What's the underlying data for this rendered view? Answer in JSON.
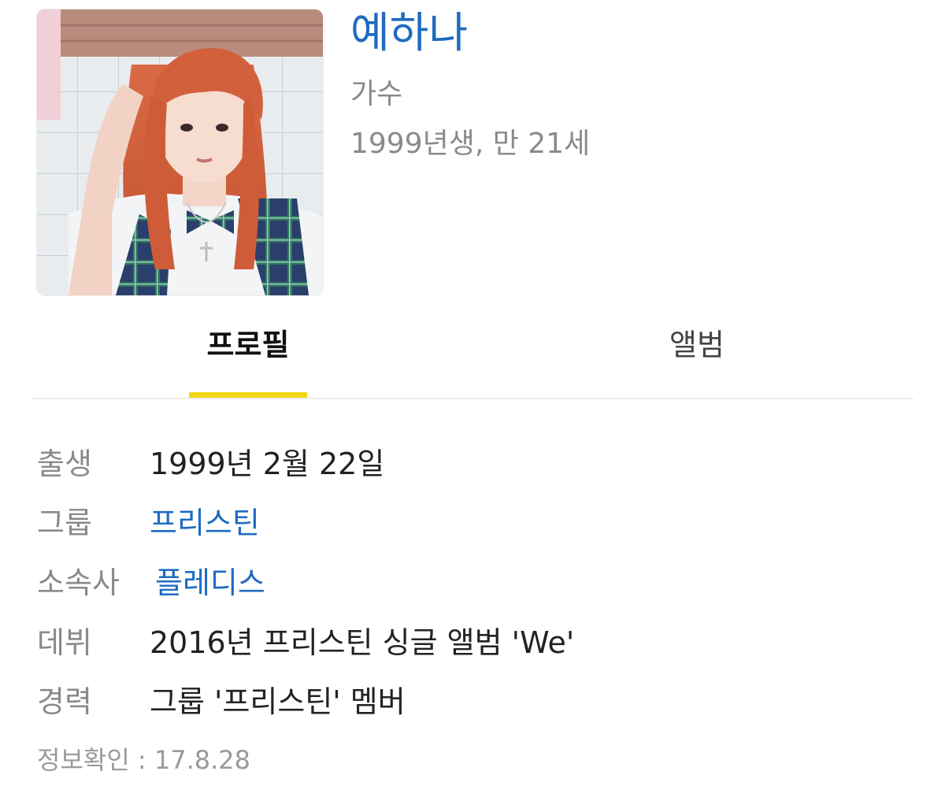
{
  "profile": {
    "name": "예하나",
    "job": "가수",
    "birth_summary": "1999년생, 만 21세",
    "photo_alt": "profile photo"
  },
  "tabs": [
    {
      "label": "프로필",
      "active": true
    },
    {
      "label": "앨범",
      "active": false
    }
  ],
  "info": {
    "birth": {
      "key": "출생",
      "value": "1999년 2월 22일"
    },
    "group": {
      "key": "그룹",
      "value": "프리스틴"
    },
    "agency": {
      "key": "소속사",
      "value": "플레디스"
    },
    "debut": {
      "key": "데뷔",
      "value": "2016년 프리스틴 싱글 앨범 'We'"
    },
    "career": {
      "key": "경력",
      "value": "그룹 '프리스틴' 멤버"
    }
  },
  "verified": "정보확인 : 17.8.28",
  "colors": {
    "link": "#1e6bc0",
    "active_tab_underline": "#f2d411",
    "muted_text": "#8a8a8a"
  }
}
